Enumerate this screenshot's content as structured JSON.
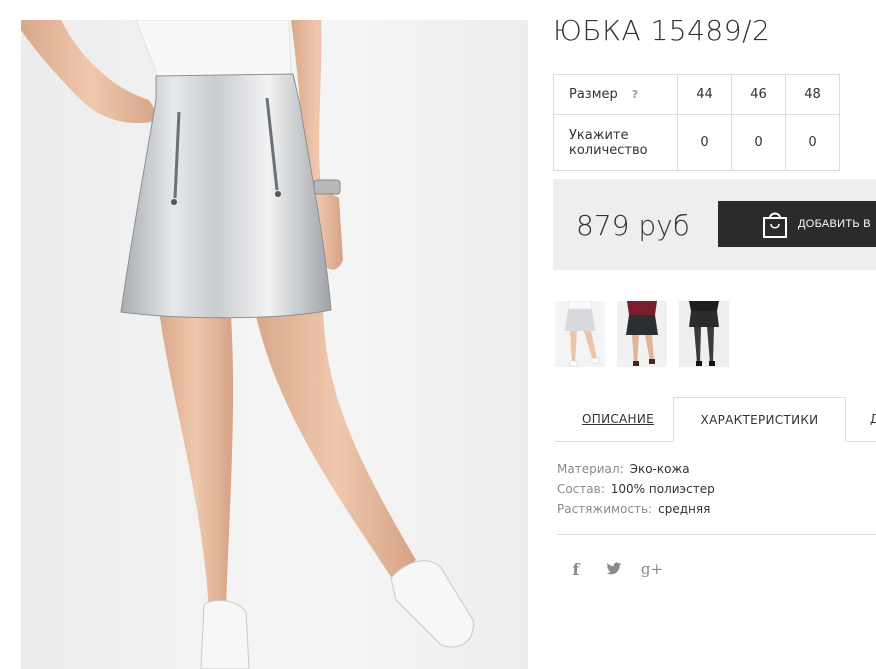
{
  "product": {
    "title": "ЮБКА 15489/2",
    "price": "879 руб",
    "add_to_cart_label": "ДОБАВИТЬ В"
  },
  "size_table": {
    "size_label": "Размер",
    "help": "?",
    "sizes": [
      "44",
      "46",
      "48"
    ],
    "quantity_label_line1": "Укажите",
    "quantity_label_line2": "количество",
    "quantities": [
      "0",
      "0",
      "0"
    ]
  },
  "thumbnails": [
    {
      "icon": "silver-skirt-thumbnail"
    },
    {
      "icon": "black-skirt-burgundy-top-thumbnail"
    },
    {
      "icon": "black-skirt-black-top-thumbnail"
    }
  ],
  "tabs": [
    {
      "label": "ОПИСАНИЕ",
      "active": false
    },
    {
      "label": "ХАРАКТЕРИСТИКИ",
      "active": true
    },
    {
      "label": "Д",
      "active": false
    }
  ],
  "specs": [
    {
      "label": "Материал:",
      "value": "Эко-кожа"
    },
    {
      "label": "Состав:",
      "value": "100% полиэстер"
    },
    {
      "label": "Растяжимость:",
      "value": "средняя"
    }
  ],
  "social": [
    {
      "icon": "facebook-icon",
      "glyph": "f"
    },
    {
      "icon": "twitter-icon",
      "glyph": ""
    },
    {
      "icon": "google-plus-icon",
      "glyph": "g+"
    }
  ],
  "colors": {
    "button_bg": "#2b2b2b",
    "price_box_bg": "#eeeeee",
    "border": "#dcdcdc",
    "muted_text": "#8a8a8a"
  }
}
